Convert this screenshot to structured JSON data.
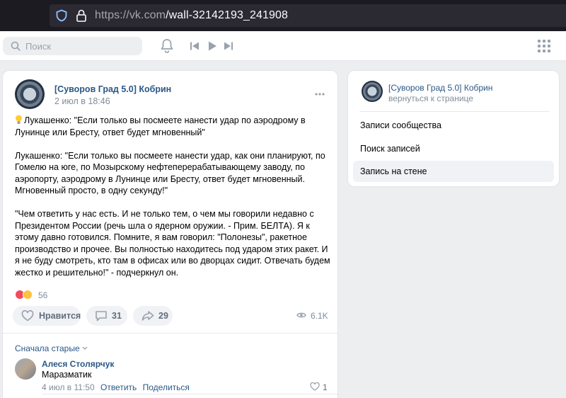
{
  "browser": {
    "url_host": "https://vk.com",
    "url_path": "/wall-32142193_241908"
  },
  "header": {
    "search_placeholder": "Поиск"
  },
  "post": {
    "author": "[Суворов Град 5.0] Кобрин",
    "date": "2 июл в 18:46",
    "paragraphs": [
      "Лукашенко: \"Если только вы посмеете нанести удар по аэродрому в Лунинце или Бресту, ответ будет мгновенный\"",
      "Лукашенко: \"Если только вы посмеете нанести удар, как они планируют, по Гомелю на юге, по Мозырскому нефтеперерабатывающему заводу, по аэропорту, аэродрому в Лунинце или Бресту, ответ будет мгновенный. Мгновенный просто, в одну секунду!\"",
      "\"Чем ответить у нас есть. И не только тем, о чем мы говорили недавно с Президентом России (речь шла о ядерном оружии. - Прим. БЕЛТА). Я к этому давно готовился. Помните, я вам говорил: \"Полонезы\", ракетное производство и прочее. Вы полностью находитесь под ударом этих ракет. И я не буду смотреть, кто там в офисах или во дворцах сидит. Отвечать будем жестко и решительно!\" - подчеркнул он."
    ],
    "reactions_count": "56",
    "like_label": "Нравится",
    "comments_count": "31",
    "shares_count": "29",
    "views": "6.1K",
    "sort_label": "Сначала старые"
  },
  "comment": {
    "author": "Алеся Столярчук",
    "text": "Маразматик",
    "date": "4 июл в 11:50",
    "reply_label": "Ответить",
    "share_label": "Поделиться",
    "likes": "1"
  },
  "sidebar": {
    "group_name": "[Суворов Град 5.0] Кобрин",
    "back_label": "вернуться к странице",
    "items": [
      {
        "label": "Записи сообщества",
        "active": false
      },
      {
        "label": "Поиск записей",
        "active": false
      },
      {
        "label": "Запись на стене",
        "active": true
      }
    ]
  },
  "colors": {
    "link": "#2a5885",
    "secondary": "#818c99",
    "background": "#edeef0"
  }
}
